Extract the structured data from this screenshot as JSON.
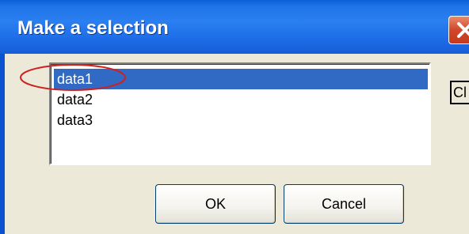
{
  "dialog": {
    "title": "Make a selection",
    "close_label": "close"
  },
  "list": {
    "items": [
      "data1",
      "data2",
      "data3"
    ],
    "selected_index": 0
  },
  "side_button": {
    "label": "Cl"
  },
  "buttons": {
    "ok_label": "OK",
    "cancel_label": "Cancel"
  },
  "colors": {
    "titlebar": "#2b7ff0",
    "selection": "#316ac5",
    "annotation": "#d02020",
    "dialog_bg": "#ece9d8"
  }
}
